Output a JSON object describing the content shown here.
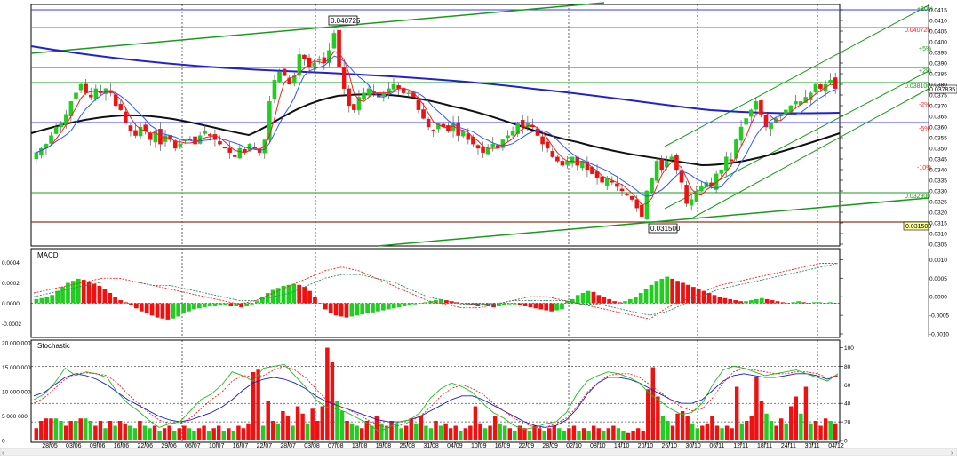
{
  "chart_data": {
    "type": "candlestick",
    "price": {
      "ylim": [
        0.0305,
        0.0415
      ],
      "ticks": [
        "0.0415",
        "0.0410",
        "0.0405",
        "0.0400",
        "0.0395",
        "0.0390",
        "0.0385",
        "0.0380",
        "0.0375",
        "0.0370",
        "0.0365",
        "0.0360",
        "0.0355",
        "0.0350",
        "0.0345",
        "0.0340",
        "0.0335",
        "0.0330",
        "0.0325",
        "0.0320",
        "0.0315",
        "0.0310",
        "0.0305"
      ],
      "close": [
        0.0348,
        0.035,
        0.0352,
        0.0356,
        0.036,
        0.0362,
        0.0366,
        0.0372,
        0.0376,
        0.038,
        0.0376,
        0.0374,
        0.0378,
        0.0376,
        0.0378,
        0.0376,
        0.037,
        0.0368,
        0.0362,
        0.0358,
        0.0356,
        0.036,
        0.0358,
        0.0354,
        0.0358,
        0.0352,
        0.0356,
        0.0354,
        0.035,
        0.0352,
        0.0354,
        0.0354,
        0.0352,
        0.0356,
        0.0358,
        0.0356,
        0.0354,
        0.0352,
        0.035,
        0.0348,
        0.0346,
        0.035,
        0.0348,
        0.0352,
        0.035,
        0.0348,
        0.0354,
        0.0372,
        0.0382,
        0.0386,
        0.0384,
        0.038,
        0.0384,
        0.0394,
        0.0392,
        0.0388,
        0.039,
        0.0392,
        0.039,
        0.0396,
        0.0404,
        0.0388,
        0.0378,
        0.037,
        0.0368,
        0.0374,
        0.0376,
        0.0378,
        0.0376,
        0.0374,
        0.0376,
        0.0378,
        0.038,
        0.0378,
        0.0376,
        0.0376,
        0.0374,
        0.0368,
        0.0364,
        0.036,
        0.0358,
        0.0362,
        0.036,
        0.0358,
        0.0362,
        0.0356,
        0.0358,
        0.0354,
        0.0352,
        0.035,
        0.0348,
        0.035,
        0.0352,
        0.035,
        0.0354,
        0.0356,
        0.0358,
        0.0362,
        0.036,
        0.0362,
        0.036,
        0.0356,
        0.0352,
        0.035,
        0.0346,
        0.0344,
        0.0342,
        0.0344,
        0.0346,
        0.0342,
        0.0344,
        0.034,
        0.0338,
        0.0336,
        0.0334,
        0.0336,
        0.0334,
        0.0332,
        0.033,
        0.0328,
        0.0326,
        0.0322,
        0.0318,
        0.033,
        0.0336,
        0.0344,
        0.034,
        0.0344,
        0.0346,
        0.034,
        0.0334,
        0.0324,
        0.0326,
        0.033,
        0.0332,
        0.0334,
        0.0332,
        0.0338,
        0.034,
        0.0346,
        0.0344,
        0.0354,
        0.036,
        0.0364,
        0.0368,
        0.0372,
        0.0366,
        0.036,
        0.0362,
        0.0364,
        0.0366,
        0.0368,
        0.037,
        0.0372,
        0.0372,
        0.0374,
        0.0376,
        0.038,
        0.0378,
        0.038,
        0.0382,
        0.0378
      ],
      "annotations": [
        "0.040725",
        "0.031500"
      ],
      "right_tags": [
        "+10%",
        "0.040725",
        "+5%",
        "+2%",
        "0.038100",
        "0.037835",
        "-2%",
        "-5%",
        "-10%",
        "0.032900",
        "0.031500"
      ]
    },
    "x_tick_labels": [
      "28/05",
      "03/06",
      "09/06",
      "16/06",
      "22/06",
      "29/06",
      "06/07",
      "10/07",
      "16/07",
      "22/07",
      "28/07",
      "03/08",
      "07/08",
      "13/08",
      "19/08",
      "25/08",
      "31/08",
      "04/09",
      "10/09",
      "16/09",
      "22/09",
      "28/09",
      "02/10",
      "08/10",
      "14/10",
      "20/10",
      "26/10",
      "30/10",
      "06/11",
      "12/11",
      "18/11",
      "24/11",
      "30/11",
      "04/12"
    ],
    "macd": {
      "title": "MACD",
      "left_ticks": [
        "0.0004",
        "0.0002",
        "0.0000",
        "-0.0002"
      ],
      "right_ticks": [
        "0.0010",
        "0.0005",
        "0.0000",
        "-0.0005",
        "-0.0010"
      ],
      "hist_ylim": [
        -0.0003,
        0.0005
      ],
      "histogram": [
        4e-05,
        5e-05,
        6e-05,
        8e-05,
        0.00012,
        0.00016,
        0.0002,
        0.00022,
        0.00024,
        0.00023,
        0.00021,
        0.00019,
        0.00017,
        0.00014,
        0.0001,
        6e-05,
        3e-05,
        1e-05,
        -2e-05,
        -5e-05,
        -8e-05,
        -0.0001,
        -0.00012,
        -0.00014,
        -0.00015,
        -0.00016,
        -0.00015,
        -0.00013,
        -0.0001,
        -8e-05,
        -6e-05,
        -5e-05,
        -4e-05,
        -3e-05,
        -3e-05,
        -2e-05,
        -2e-05,
        -3e-05,
        -3e-05,
        -4e-05,
        -3e-05,
        -1e-05,
        2e-05,
        6e-05,
        0.0001,
        0.00013,
        0.00015,
        0.00017,
        0.00018,
        0.00019,
        0.00018,
        0.00016,
        0.00012,
        6e-05,
        0.0,
        -6e-05,
        -0.0001,
        -0.00012,
        -0.00013,
        -0.00014,
        -0.00013,
        -0.00012,
        -0.00011,
        -0.0001,
        -9e-05,
        -8e-05,
        -7e-05,
        -6e-05,
        -5e-05,
        -4e-05,
        -3e-05,
        -2e-05,
        -1e-05,
        0.0,
        1e-05,
        2e-05,
        3e-05,
        4e-05,
        3e-05,
        2e-05,
        1e-05,
        0.0,
        -1e-05,
        -2e-05,
        -3e-05,
        -2e-05,
        -3e-05,
        -4e-05,
        -3e-05,
        -2e-05,
        -1e-05,
        -1e-05,
        -2e-05,
        -3e-05,
        -4e-05,
        -5e-05,
        -6e-05,
        -7e-05,
        -8e-05,
        -7e-05,
        -6e-05,
        2e-05,
        4e-05,
        8e-05,
        0.0001,
        0.00012,
        0.00011,
        8e-05,
        6e-05,
        4e-05,
        2e-05,
        1e-05,
        2e-05,
        4e-05,
        6e-05,
        0.0001,
        0.00014,
        0.00018,
        0.00022,
        0.00024,
        0.00026,
        0.00024,
        0.00022,
        0.0002,
        0.00018,
        0.00016,
        0.00014,
        0.00012,
        0.0001,
        8e-05,
        6e-05,
        5e-05,
        4e-05,
        3e-05,
        2e-05,
        2e-05,
        3e-05,
        4e-05,
        5e-05,
        4e-05,
        3e-05,
        2e-05,
        1e-05,
        0.0,
        1e-05,
        2e-05,
        1e-05,
        0.0,
        1e-05,
        1e-05,
        0.0,
        1e-05,
        0.0
      ],
      "line_ylim": [
        -0.001,
        0.0012
      ],
      "macd_line": [
        0.0001,
        0.0002,
        0.0003,
        0.0004,
        0.0005,
        0.0005,
        0.0004,
        0.0003,
        0.0002,
        0.0001,
        0.0,
        -0.0001,
        -0.0002,
        -0.0001,
        0.0001,
        0.0003,
        0.0005,
        0.0007,
        0.0008,
        0.0007,
        0.0005,
        0.0003,
        0.0001,
        -0.0001,
        -0.0002,
        -0.0003,
        -0.0003,
        -0.0002,
        -0.0001,
        0.0,
        0.0,
        -0.0001,
        -0.0002,
        -0.0003,
        -0.0004,
        -0.0005,
        -0.0006,
        -0.0003,
        -0.0001,
        0.0001,
        0.0003,
        0.0004,
        0.0005,
        0.0006,
        0.0007,
        0.0008,
        0.0009,
        0.0009
      ],
      "signal_line": [
        0.0,
        0.0001,
        0.0002,
        0.0003,
        0.0004,
        0.0004,
        0.0004,
        0.0003,
        0.0003,
        0.0002,
        0.0001,
        0.0,
        -0.0001,
        -0.0001,
        0.0,
        0.0001,
        0.0003,
        0.0005,
        0.0006,
        0.0006,
        0.0005,
        0.0004,
        0.0002,
        0.0,
        -0.0001,
        -0.0002,
        -0.0002,
        -0.0002,
        -0.0001,
        -0.0001,
        -0.0001,
        -0.0001,
        -0.0002,
        -0.0002,
        -0.0003,
        -0.0004,
        -0.0005,
        -0.0004,
        -0.0002,
        0.0,
        0.0002,
        0.0003,
        0.0004,
        0.0005,
        0.0006,
        0.0007,
        0.0008,
        0.0009
      ]
    },
    "stochastic": {
      "title": "Stochastic",
      "left_ticks": [
        "20 000 000",
        "15 000 000",
        "10 000 000",
        "5 000 000",
        "0"
      ],
      "right_ticks": [
        "100",
        "80",
        "60",
        "40",
        "20",
        "0"
      ],
      "volume_ylim": [
        0,
        20000000
      ],
      "volume": [
        2500000,
        4000000,
        4500000,
        4500000,
        4500000,
        4000000,
        3000000,
        4000000,
        4000000,
        4500000,
        4500000,
        4000000,
        3000000,
        4000000,
        2500000,
        4000000,
        3000000,
        4000000,
        3500000,
        3000000,
        2500000,
        4000000,
        3000000,
        2500000,
        3000000,
        2000000,
        2500000,
        3000000,
        2000000,
        2500000,
        3000000,
        2500000,
        2000000,
        2500000,
        3000000,
        2000000,
        2500000,
        3000000,
        2000000,
        2500000,
        2000000,
        3000000,
        2500000,
        3500000,
        14000000,
        14500000,
        3000000,
        8000000,
        4000000,
        3500000,
        6000000,
        5000000,
        3000000,
        7000000,
        5500000,
        3500000,
        6500000,
        4000000,
        7000000,
        19000000,
        16000000,
        8000000,
        6000000,
        4000000,
        3500000,
        3000000,
        2500000,
        4000000,
        3000000,
        5000000,
        3500000,
        3000000,
        4000000,
        3500000,
        2500000,
        3000000,
        4500000,
        3500000,
        5000000,
        3000000,
        2500000,
        4000000,
        3000000,
        3500000,
        2500000,
        3000000,
        2000000,
        2500000,
        3000000,
        7000000,
        3500000,
        2500000,
        3000000,
        5000000,
        3500000,
        3000000,
        2500000,
        2000000,
        3000000,
        2500000,
        2000000,
        3000000,
        2500000,
        2000000,
        2500000,
        3000000,
        2500000,
        2000000,
        2500000,
        3000000,
        2000000,
        2500000,
        2000000,
        3000000,
        2500000,
        2000000,
        2500000,
        3000000,
        2500000,
        2000000,
        1500000,
        2000000,
        2500000,
        2000000,
        10500000,
        15000000,
        9000000,
        5000000,
        4000000,
        3000000,
        5500000,
        6000000,
        5000000,
        3500000,
        2500000,
        3000000,
        3500000,
        5000000,
        3000000,
        2500000,
        3000000,
        2500000,
        11000000,
        3500000,
        4000000,
        5000000,
        13000000,
        8000000,
        5500000,
        4000000,
        3000000,
        4500000,
        3500000,
        7000000,
        9000000,
        5500000,
        11000000,
        3500000,
        4000000,
        3000000,
        4500000,
        4000000,
        3500000
      ],
      "k_line": [
        44,
        50,
        62,
        78,
        70,
        74,
        72,
        68,
        52,
        40,
        32,
        22,
        14,
        18,
        20,
        32,
        44,
        50,
        60,
        74,
        70,
        64,
        78,
        80,
        82,
        70,
        58,
        44,
        36,
        34,
        30,
        24,
        18,
        10,
        14,
        20,
        22,
        30,
        46,
        56,
        62,
        58,
        52,
        40,
        30,
        24,
        16,
        12,
        14,
        18,
        20,
        30,
        50,
        64,
        70,
        74,
        72,
        68,
        62,
        50,
        42,
        34,
        28,
        30,
        40,
        60,
        76,
        80,
        78,
        74,
        70,
        72,
        74,
        76,
        72,
        68,
        64,
        72
      ],
      "d_line": [
        40,
        46,
        56,
        66,
        72,
        73,
        72,
        70,
        62,
        50,
        40,
        30,
        22,
        18,
        18,
        24,
        34,
        44,
        52,
        64,
        70,
        69,
        70,
        76,
        80,
        76,
        68,
        56,
        44,
        38,
        34,
        28,
        22,
        16,
        14,
        16,
        20,
        26,
        36,
        48,
        56,
        60,
        56,
        50,
        40,
        32,
        24,
        18,
        14,
        14,
        18,
        24,
        36,
        52,
        62,
        70,
        72,
        72,
        68,
        60,
        52,
        44,
        36,
        32,
        34,
        46,
        62,
        74,
        78,
        76,
        74,
        72,
        72,
        74,
        74,
        72,
        68,
        70
      ],
      "vol_ma": [
        48,
        52,
        60,
        68,
        72,
        70,
        66,
        60,
        52,
        44,
        38,
        32,
        26,
        22,
        20,
        22,
        26,
        30,
        36,
        44,
        54,
        62,
        66,
        68,
        66,
        62,
        56,
        48,
        42,
        38,
        34,
        30,
        26,
        22,
        20,
        20,
        22,
        26,
        32,
        38,
        44,
        48,
        48,
        44,
        38,
        32,
        26,
        20,
        16,
        14,
        16,
        22,
        34,
        50,
        62,
        68,
        68,
        66,
        62,
        56,
        50,
        44,
        40,
        40,
        44,
        54,
        64,
        70,
        72,
        70,
        68,
        68,
        70,
        72,
        72,
        70,
        66,
        70
      ]
    }
  }
}
